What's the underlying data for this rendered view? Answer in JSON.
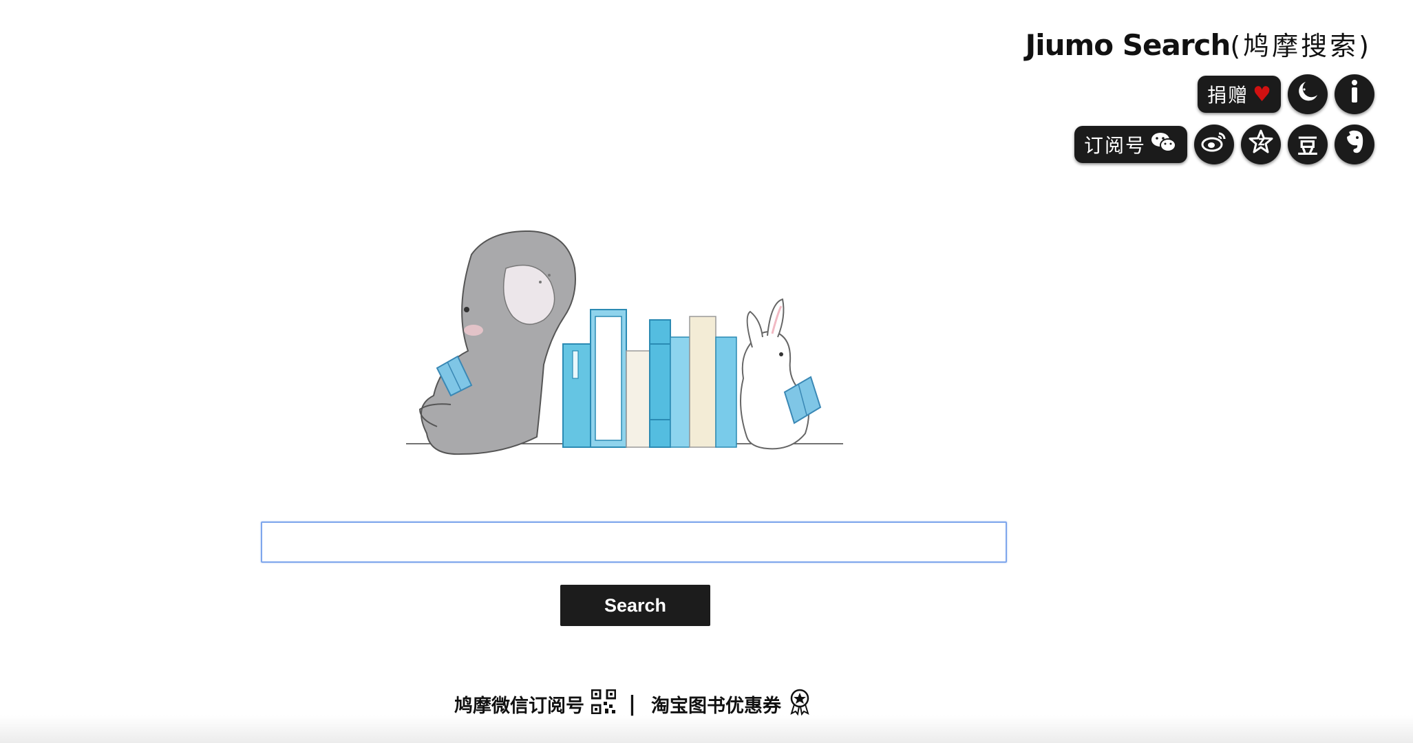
{
  "brand": {
    "title": "Jiumo Search",
    "subtitle": "(鸠摩搜索)"
  },
  "toolbar": {
    "donate_label": "捐赠",
    "donate_icon": "heart-icon",
    "night_mode_icon": "moon-icon",
    "info_icon": "info-icon",
    "subscribe_label": "订阅号",
    "subscribe_icon": "wechat-icon",
    "weibo_icon": "weibo-icon",
    "star_icon": "star-icon",
    "douban_label": "豆",
    "evernote_icon": "evernote-icon",
    "heart_color": "#d11111"
  },
  "search": {
    "input_value": "",
    "placeholder": "",
    "button_label": "Search"
  },
  "footer": {
    "wechat_link": "鸠摩微信订阅号",
    "wechat_link_icon": "qr-code-icon",
    "separator": "|",
    "taobao_link": "淘宝图书优惠券",
    "taobao_link_icon": "coupon-badge-icon"
  }
}
